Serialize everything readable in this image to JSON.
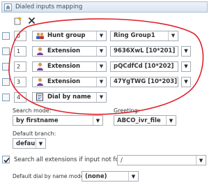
{
  "panel": {
    "title": "Dialed inputs mapping"
  },
  "rows": [
    {
      "num": "0",
      "type": "Hunt group",
      "type_icon": "group-icon",
      "target": "Ring Group1"
    },
    {
      "num": "1",
      "type": "Extension",
      "type_icon": "user-icon",
      "target": "9636XwL [10*201]"
    },
    {
      "num": "2",
      "type": "Extension",
      "type_icon": "user-icon",
      "target": "pQCdfCd [10*202]"
    },
    {
      "num": "3",
      "type": "Extension",
      "type_icon": "user-icon",
      "target": "47YgTWG [10*203]"
    },
    {
      "num": "4",
      "type": "Dial by name",
      "type_icon": "dial-by-name-icon",
      "target": ""
    }
  ],
  "search_mode": {
    "label": "Search mode:",
    "value": "by firstname"
  },
  "greeting": {
    "label": "Greeting:",
    "value": "ABCO_ivr_file"
  },
  "default_branch": {
    "label": "Default branch:",
    "value": "default"
  },
  "search_all": {
    "label": "Search all extensions if input not found:",
    "value": "/",
    "checked": true
  },
  "dial_by_name_mode": {
    "label": "Default dial by name mode:",
    "value": "(none)"
  },
  "colors": {
    "annotation": "#e0202a",
    "header_bg": "#dbe6f1"
  }
}
